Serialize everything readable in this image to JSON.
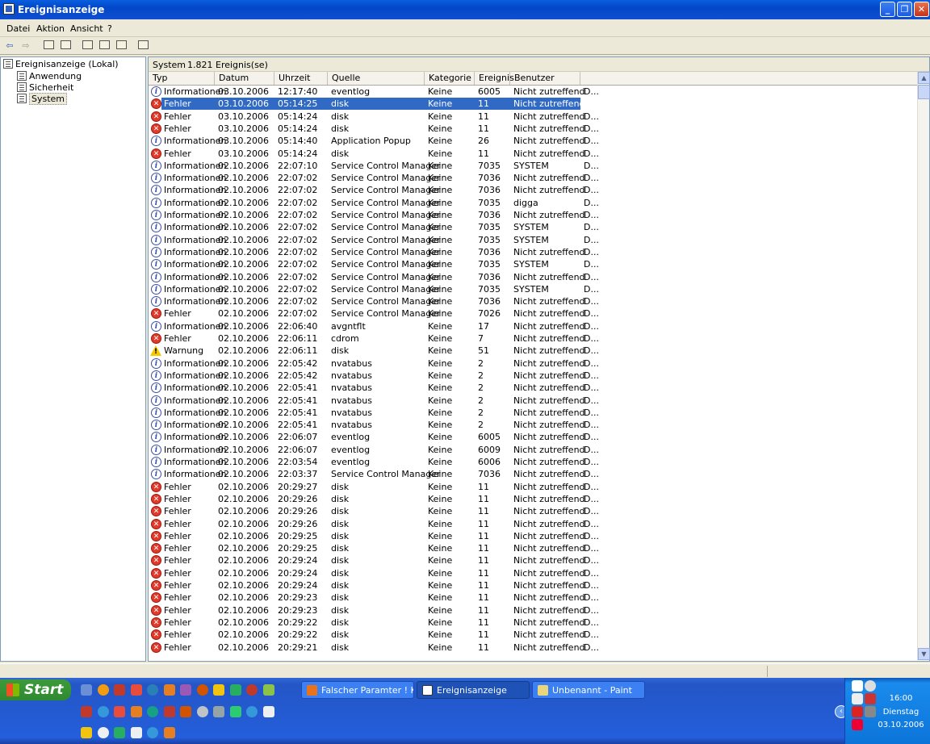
{
  "window": {
    "title": "Ereignisanzeige"
  },
  "menu": [
    "Datei",
    "Aktion",
    "Ansicht",
    "?"
  ],
  "toolbar": {
    "back": "⇦",
    "forward": "⇨"
  },
  "tree": {
    "root": "Ereignisanzeige (Lokal)",
    "items": [
      "Anwendung",
      "Sicherheit",
      "System"
    ],
    "selected": "System"
  },
  "header": {
    "log": "System",
    "count": "1.821 Ereignis(se)"
  },
  "columns": [
    "Typ",
    "Datum",
    "Uhrzeit",
    "Quelle",
    "Kategorie",
    "Ereignis",
    "Benutzer",
    ""
  ],
  "rows": [
    [
      "info",
      "Informationen",
      "03.10.2006",
      "12:17:40",
      "eventlog",
      "Keine",
      "6005",
      "Nicht zutreffend",
      "D..."
    ],
    [
      "err",
      "Fehler",
      "03.10.2006",
      "05:14:25",
      "disk",
      "Keine",
      "11",
      "Nicht zutreffend",
      ""
    ],
    [
      "err",
      "Fehler",
      "03.10.2006",
      "05:14:24",
      "disk",
      "Keine",
      "11",
      "Nicht zutreffend",
      "D..."
    ],
    [
      "err",
      "Fehler",
      "03.10.2006",
      "05:14:24",
      "disk",
      "Keine",
      "11",
      "Nicht zutreffend",
      "D..."
    ],
    [
      "info",
      "Informationen",
      "03.10.2006",
      "05:14:40",
      "Application Popup",
      "Keine",
      "26",
      "Nicht zutreffend",
      "D..."
    ],
    [
      "err",
      "Fehler",
      "03.10.2006",
      "05:14:24",
      "disk",
      "Keine",
      "11",
      "Nicht zutreffend",
      "D..."
    ],
    [
      "info",
      "Informationen",
      "02.10.2006",
      "22:07:10",
      "Service Control Manager",
      "Keine",
      "7035",
      "SYSTEM",
      "D..."
    ],
    [
      "info",
      "Informationen",
      "02.10.2006",
      "22:07:02",
      "Service Control Manager",
      "Keine",
      "7036",
      "Nicht zutreffend",
      "D..."
    ],
    [
      "info",
      "Informationen",
      "02.10.2006",
      "22:07:02",
      "Service Control Manager",
      "Keine",
      "7036",
      "Nicht zutreffend",
      "D..."
    ],
    [
      "info",
      "Informationen",
      "02.10.2006",
      "22:07:02",
      "Service Control Manager",
      "Keine",
      "7035",
      "digga",
      "D..."
    ],
    [
      "info",
      "Informationen",
      "02.10.2006",
      "22:07:02",
      "Service Control Manager",
      "Keine",
      "7036",
      "Nicht zutreffend",
      "D..."
    ],
    [
      "info",
      "Informationen",
      "02.10.2006",
      "22:07:02",
      "Service Control Manager",
      "Keine",
      "7035",
      "SYSTEM",
      "D..."
    ],
    [
      "info",
      "Informationen",
      "02.10.2006",
      "22:07:02",
      "Service Control Manager",
      "Keine",
      "7035",
      "SYSTEM",
      "D..."
    ],
    [
      "info",
      "Informationen",
      "02.10.2006",
      "22:07:02",
      "Service Control Manager",
      "Keine",
      "7036",
      "Nicht zutreffend",
      "D..."
    ],
    [
      "info",
      "Informationen",
      "02.10.2006",
      "22:07:02",
      "Service Control Manager",
      "Keine",
      "7035",
      "SYSTEM",
      "D..."
    ],
    [
      "info",
      "Informationen",
      "02.10.2006",
      "22:07:02",
      "Service Control Manager",
      "Keine",
      "7036",
      "Nicht zutreffend",
      "D..."
    ],
    [
      "info",
      "Informationen",
      "02.10.2006",
      "22:07:02",
      "Service Control Manager",
      "Keine",
      "7035",
      "SYSTEM",
      "D..."
    ],
    [
      "info",
      "Informationen",
      "02.10.2006",
      "22:07:02",
      "Service Control Manager",
      "Keine",
      "7036",
      "Nicht zutreffend",
      "D..."
    ],
    [
      "err",
      "Fehler",
      "02.10.2006",
      "22:07:02",
      "Service Control Manager",
      "Keine",
      "7026",
      "Nicht zutreffend",
      "D..."
    ],
    [
      "info",
      "Informationen",
      "02.10.2006",
      "22:06:40",
      "avgntflt",
      "Keine",
      "17",
      "Nicht zutreffend",
      "D..."
    ],
    [
      "err",
      "Fehler",
      "02.10.2006",
      "22:06:11",
      "cdrom",
      "Keine",
      "7",
      "Nicht zutreffend",
      "D..."
    ],
    [
      "warn",
      "Warnung",
      "02.10.2006",
      "22:06:11",
      "disk",
      "Keine",
      "51",
      "Nicht zutreffend",
      "D..."
    ],
    [
      "info",
      "Informationen",
      "02.10.2006",
      "22:05:42",
      "nvatabus",
      "Keine",
      "2",
      "Nicht zutreffend",
      "D..."
    ],
    [
      "info",
      "Informationen",
      "02.10.2006",
      "22:05:42",
      "nvatabus",
      "Keine",
      "2",
      "Nicht zutreffend",
      "D..."
    ],
    [
      "info",
      "Informationen",
      "02.10.2006",
      "22:05:41",
      "nvatabus",
      "Keine",
      "2",
      "Nicht zutreffend",
      "D..."
    ],
    [
      "info",
      "Informationen",
      "02.10.2006",
      "22:05:41",
      "nvatabus",
      "Keine",
      "2",
      "Nicht zutreffend",
      "D..."
    ],
    [
      "info",
      "Informationen",
      "02.10.2006",
      "22:05:41",
      "nvatabus",
      "Keine",
      "2",
      "Nicht zutreffend",
      "D..."
    ],
    [
      "info",
      "Informationen",
      "02.10.2006",
      "22:05:41",
      "nvatabus",
      "Keine",
      "2",
      "Nicht zutreffend",
      "D..."
    ],
    [
      "info",
      "Informationen",
      "02.10.2006",
      "22:06:07",
      "eventlog",
      "Keine",
      "6005",
      "Nicht zutreffend",
      "D..."
    ],
    [
      "info",
      "Informationen",
      "02.10.2006",
      "22:06:07",
      "eventlog",
      "Keine",
      "6009",
      "Nicht zutreffend",
      "D..."
    ],
    [
      "info",
      "Informationen",
      "02.10.2006",
      "22:03:54",
      "eventlog",
      "Keine",
      "6006",
      "Nicht zutreffend",
      "D..."
    ],
    [
      "info",
      "Informationen",
      "02.10.2006",
      "22:03:37",
      "Service Control Manager",
      "Keine",
      "7036",
      "Nicht zutreffend",
      "D..."
    ],
    [
      "err",
      "Fehler",
      "02.10.2006",
      "20:29:27",
      "disk",
      "Keine",
      "11",
      "Nicht zutreffend",
      "D..."
    ],
    [
      "err",
      "Fehler",
      "02.10.2006",
      "20:29:26",
      "disk",
      "Keine",
      "11",
      "Nicht zutreffend",
      "D..."
    ],
    [
      "err",
      "Fehler",
      "02.10.2006",
      "20:29:26",
      "disk",
      "Keine",
      "11",
      "Nicht zutreffend",
      "D..."
    ],
    [
      "err",
      "Fehler",
      "02.10.2006",
      "20:29:26",
      "disk",
      "Keine",
      "11",
      "Nicht zutreffend",
      "D..."
    ],
    [
      "err",
      "Fehler",
      "02.10.2006",
      "20:29:25",
      "disk",
      "Keine",
      "11",
      "Nicht zutreffend",
      "D..."
    ],
    [
      "err",
      "Fehler",
      "02.10.2006",
      "20:29:25",
      "disk",
      "Keine",
      "11",
      "Nicht zutreffend",
      "D..."
    ],
    [
      "err",
      "Fehler",
      "02.10.2006",
      "20:29:24",
      "disk",
      "Keine",
      "11",
      "Nicht zutreffend",
      "D..."
    ],
    [
      "err",
      "Fehler",
      "02.10.2006",
      "20:29:24",
      "disk",
      "Keine",
      "11",
      "Nicht zutreffend",
      "D..."
    ],
    [
      "err",
      "Fehler",
      "02.10.2006",
      "20:29:24",
      "disk",
      "Keine",
      "11",
      "Nicht zutreffend",
      "D..."
    ],
    [
      "err",
      "Fehler",
      "02.10.2006",
      "20:29:23",
      "disk",
      "Keine",
      "11",
      "Nicht zutreffend",
      "D..."
    ],
    [
      "err",
      "Fehler",
      "02.10.2006",
      "20:29:23",
      "disk",
      "Keine",
      "11",
      "Nicht zutreffend",
      "D..."
    ],
    [
      "err",
      "Fehler",
      "02.10.2006",
      "20:29:22",
      "disk",
      "Keine",
      "11",
      "Nicht zutreffend",
      "D..."
    ],
    [
      "err",
      "Fehler",
      "02.10.2006",
      "20:29:22",
      "disk",
      "Keine",
      "11",
      "Nicht zutreffend",
      "D..."
    ],
    [
      "err",
      "Fehler",
      "02.10.2006",
      "20:29:21",
      "disk",
      "Keine",
      "11",
      "Nicht zutreffend",
      "D..."
    ]
  ],
  "selected_row": 1,
  "taskbar": {
    "start": "Start",
    "tasks": [
      {
        "label": "Falscher Paramter ! K...",
        "icon": "firefox-icon"
      },
      {
        "label": "Ereignisanzeige",
        "icon": "event-viewer-icon"
      },
      {
        "label": "Unbenannt - Paint",
        "icon": "paint-icon"
      }
    ],
    "active_task": 1,
    "clock": {
      "time": "16:00",
      "day": "Dienstag",
      "date": "03.10.2006"
    }
  }
}
